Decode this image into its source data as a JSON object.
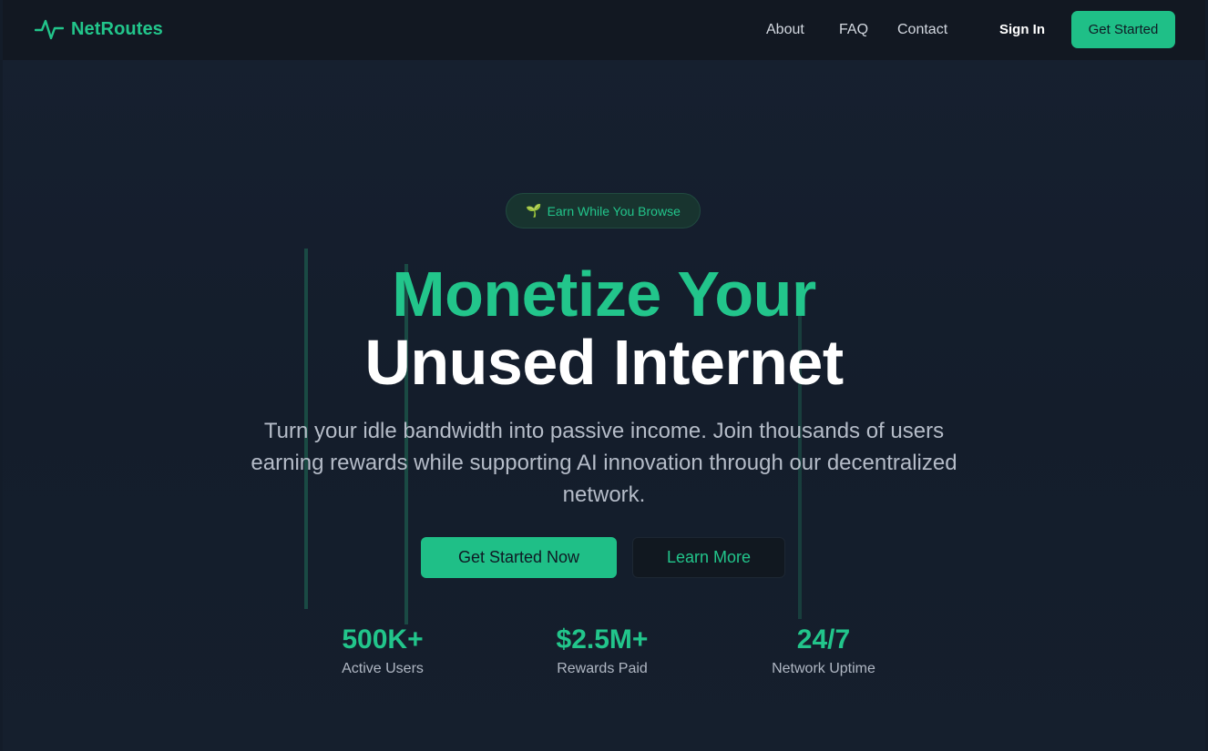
{
  "nav": {
    "brand": "NetRoutes",
    "links": [
      "About",
      "FAQ",
      "Contact"
    ],
    "sign_in": "Sign In",
    "cta": "Get Started"
  },
  "hero": {
    "badge_icon": "sprout-icon",
    "badge_text": "Earn While You Browse",
    "title_line1": "Monetize Your",
    "title_line2": "Unused Internet",
    "subtitle": "Turn your idle bandwidth into passive income. Join thousands of users earning rewards while supporting AI innovation through our decentralized network.",
    "primary_button": "Get Started Now",
    "secondary_button": "Learn More"
  },
  "stats": [
    {
      "value": "500K+",
      "label": "Active Users"
    },
    {
      "value": "$2.5M+",
      "label": "Rewards Paid"
    },
    {
      "value": "24/7",
      "label": "Network Uptime"
    }
  ],
  "colors": {
    "accent": "#22c58b",
    "background": "#141d2b",
    "navbar": "#121822"
  }
}
